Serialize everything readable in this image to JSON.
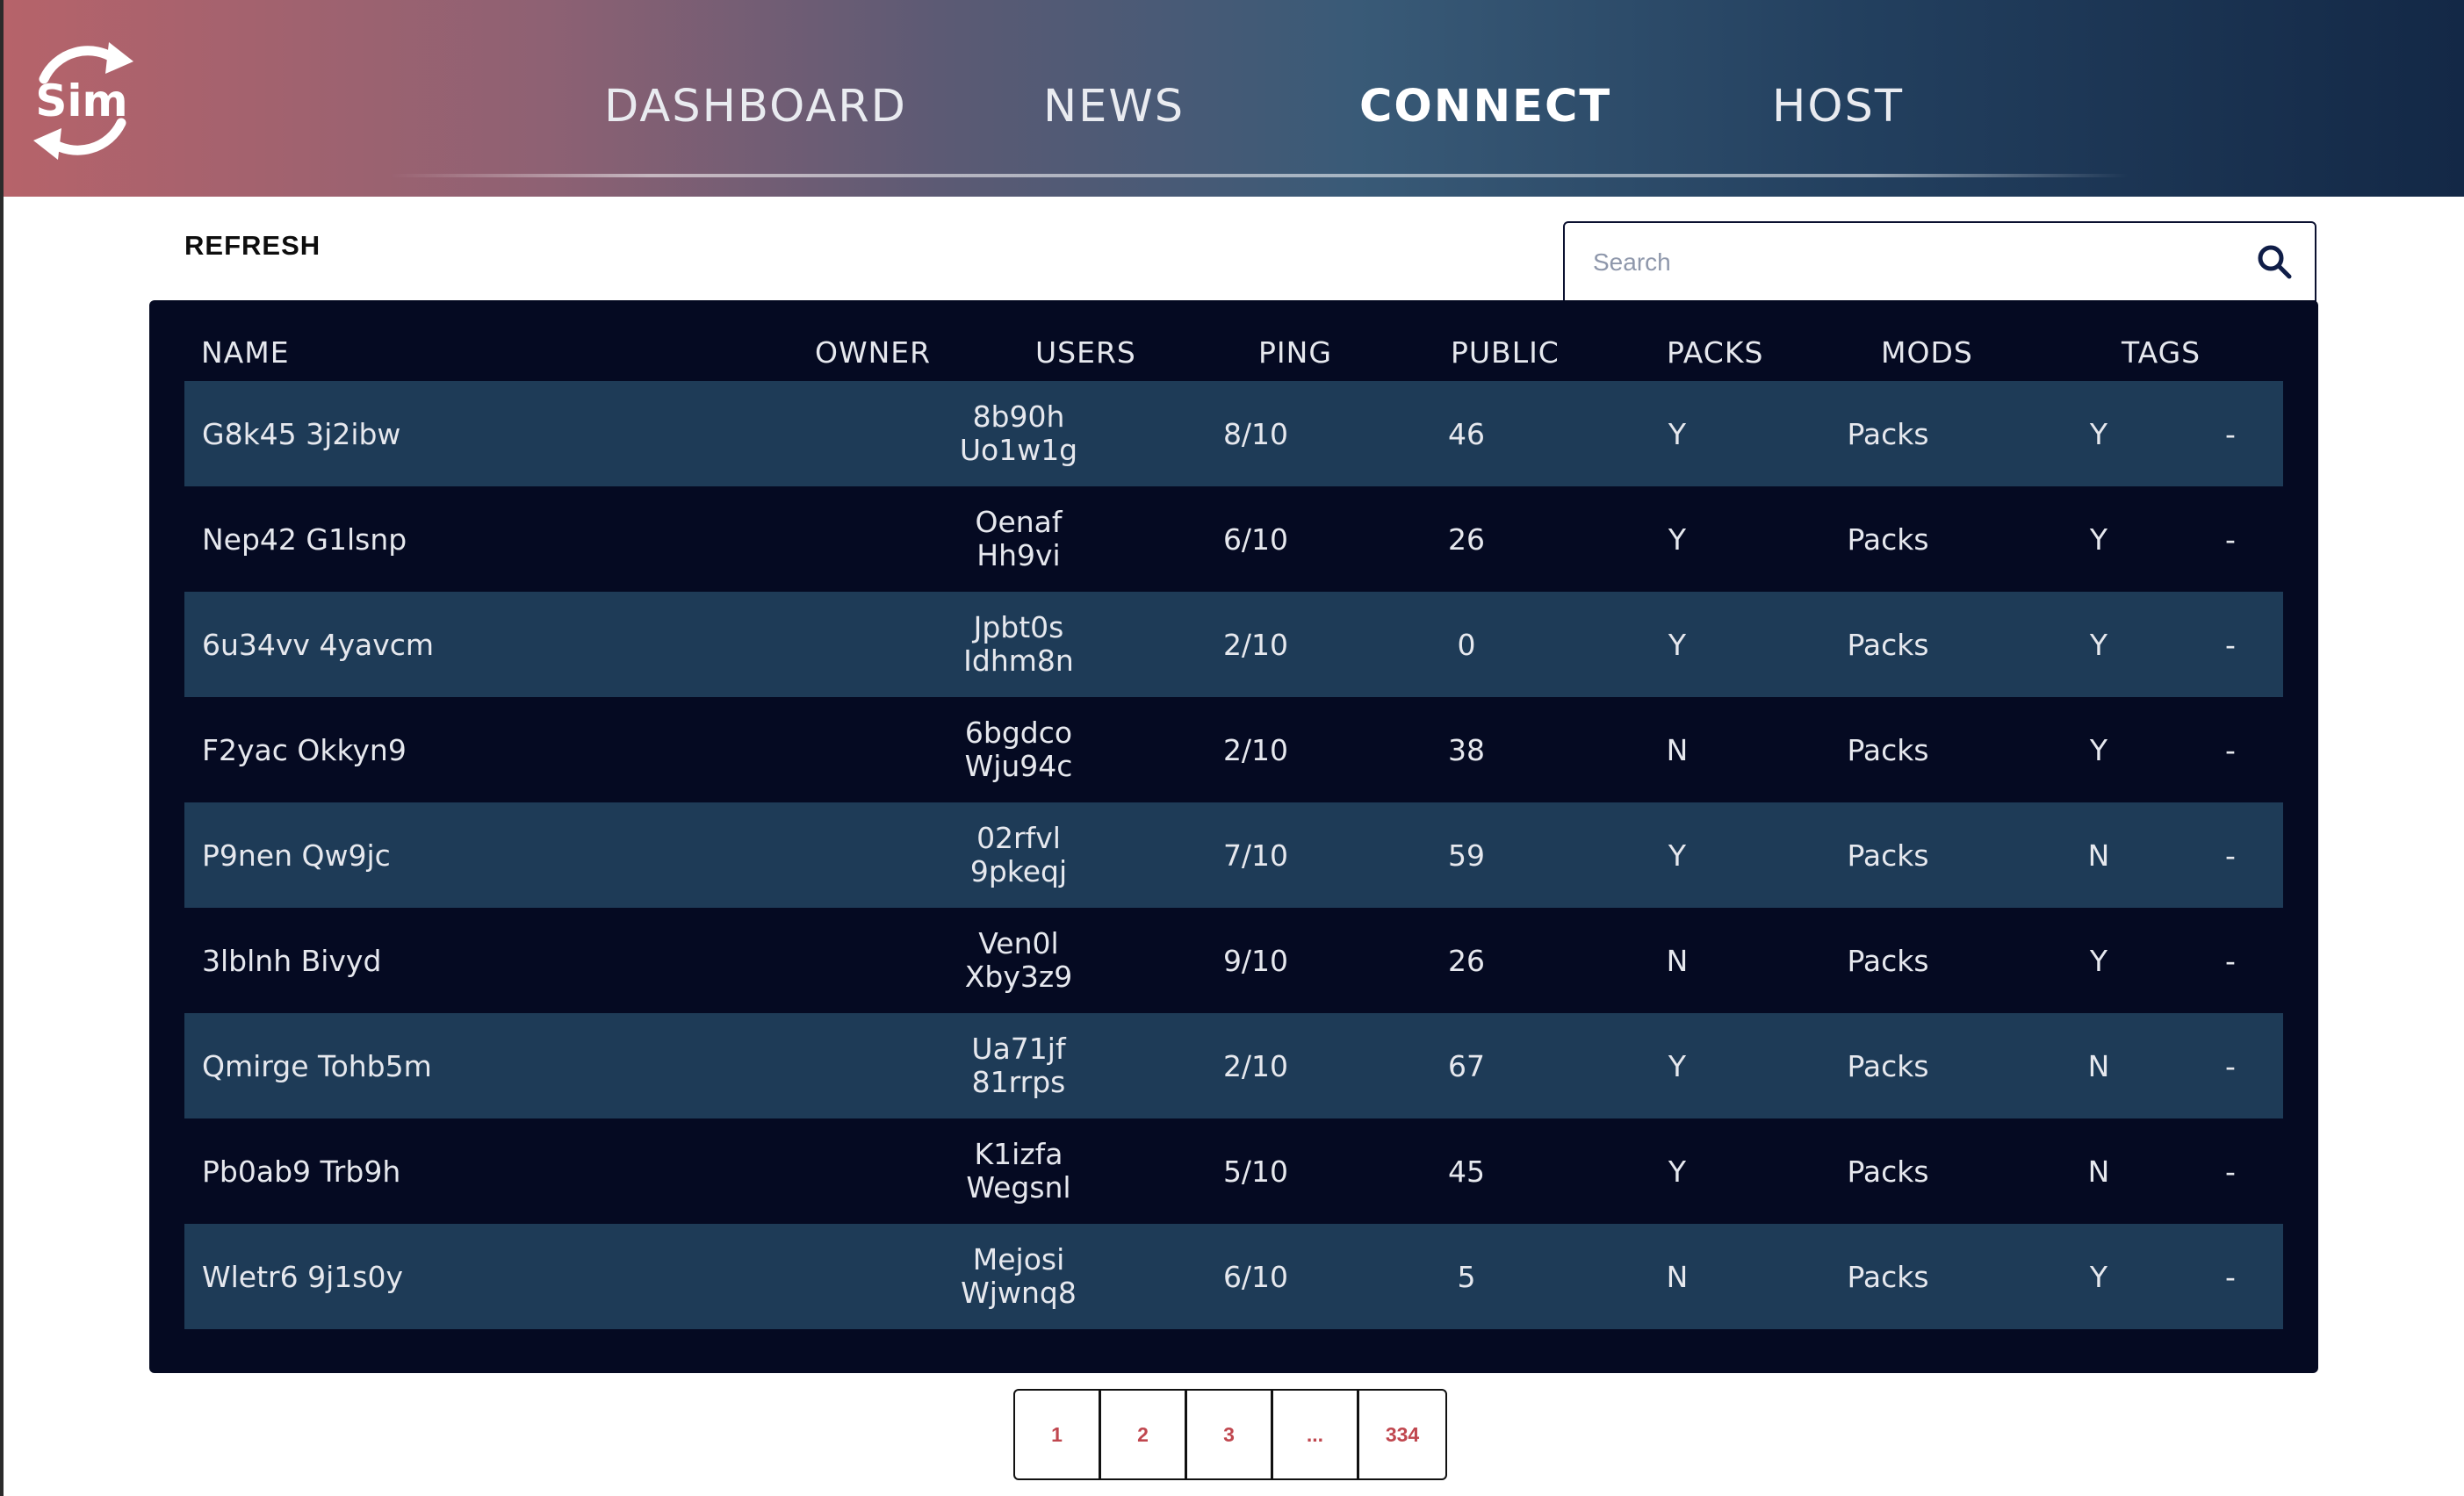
{
  "nav": {
    "logo_text": "Sim",
    "items": [
      {
        "label": "DASHBOARD",
        "active": false
      },
      {
        "label": "NEWS",
        "active": false
      },
      {
        "label": "CONNECT",
        "active": true
      },
      {
        "label": "HOST",
        "active": false
      }
    ]
  },
  "toolbar": {
    "refresh_label": "REFRESH",
    "search_placeholder": "Search",
    "search_value": ""
  },
  "table": {
    "columns": [
      "NAME",
      "OWNER",
      "USERS",
      "PING",
      "PUBLIC",
      "PACKS",
      "MODS",
      "TAGS"
    ],
    "rows": [
      {
        "name": "G8k45 3j2ibw",
        "owner_line1": "8b90h",
        "owner_line2": "Uo1w1g",
        "users": "8/10",
        "ping": "46",
        "public": "Y",
        "packs": "Packs",
        "mods": "Y",
        "tags": "-"
      },
      {
        "name": "Nep42 G1lsnp",
        "owner_line1": "Oenaf",
        "owner_line2": "Hh9vi",
        "users": "6/10",
        "ping": "26",
        "public": "Y",
        "packs": "Packs",
        "mods": "Y",
        "tags": "-"
      },
      {
        "name": "6u34vv 4yavcm",
        "owner_line1": "Jpbt0s",
        "owner_line2": "Idhm8n",
        "users": "2/10",
        "ping": "0",
        "public": "Y",
        "packs": "Packs",
        "mods": "Y",
        "tags": "-"
      },
      {
        "name": "F2yac Okkyn9",
        "owner_line1": "6bgdco",
        "owner_line2": "Wju94c",
        "users": "2/10",
        "ping": "38",
        "public": "N",
        "packs": "Packs",
        "mods": "Y",
        "tags": "-"
      },
      {
        "name": "P9nen Qw9jc",
        "owner_line1": "02rfvl",
        "owner_line2": "9pkeqj",
        "users": "7/10",
        "ping": "59",
        "public": "Y",
        "packs": "Packs",
        "mods": "N",
        "tags": "-"
      },
      {
        "name": "3lblnh Bivyd",
        "owner_line1": "Ven0l",
        "owner_line2": "Xby3z9",
        "users": "9/10",
        "ping": "26",
        "public": "N",
        "packs": "Packs",
        "mods": "Y",
        "tags": "-"
      },
      {
        "name": "Qmirge Tohb5m",
        "owner_line1": "Ua71jf",
        "owner_line2": "81rrps",
        "users": "2/10",
        "ping": "67",
        "public": "Y",
        "packs": "Packs",
        "mods": "N",
        "tags": "-"
      },
      {
        "name": "Pb0ab9 Trb9h",
        "owner_line1": "K1izfa",
        "owner_line2": "Wegsnl",
        "users": "5/10",
        "ping": "45",
        "public": "Y",
        "packs": "Packs",
        "mods": "N",
        "tags": "-"
      },
      {
        "name": "Wletr6 9j1s0y",
        "owner_line1": "Mejosi",
        "owner_line2": "Wjwnq8",
        "users": "6/10",
        "ping": "5",
        "public": "N",
        "packs": "Packs",
        "mods": "Y",
        "tags": "-"
      }
    ]
  },
  "pagination": {
    "pages": [
      "1",
      "2",
      "3",
      "...",
      "334"
    ]
  }
}
